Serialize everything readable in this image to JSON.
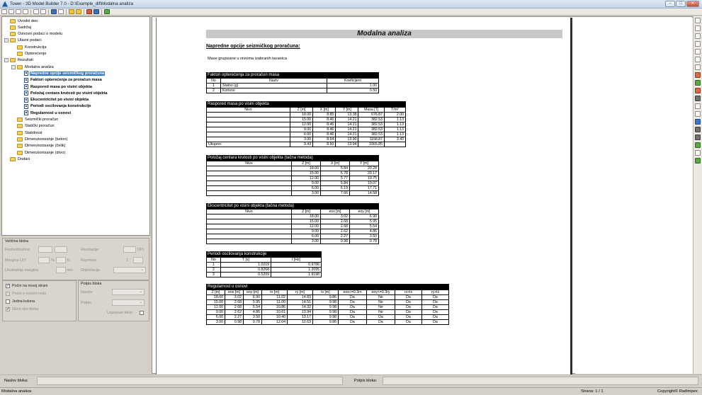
{
  "window": {
    "title": "Tower - 3D Model Builder 7.0 - D:\\Example_dif\\Modalna analiza",
    "minimize": "–",
    "maximize": "□",
    "close": "✕"
  },
  "tree": [
    {
      "label": "Uvodni deo",
      "indent": 0,
      "icon": "folder",
      "expander": "",
      "bold": false,
      "selected": false
    },
    {
      "label": "Sadržaj",
      "indent": 0,
      "icon": "folder",
      "expander": "",
      "bold": false,
      "selected": false
    },
    {
      "label": "Osnovni podaci o modelu",
      "indent": 0,
      "icon": "folder",
      "expander": "",
      "bold": false,
      "selected": false
    },
    {
      "label": "Ulazni podaci",
      "indent": 0,
      "icon": "folder",
      "expander": "−",
      "bold": false,
      "selected": false
    },
    {
      "label": "Konstrukcija",
      "indent": 1,
      "icon": "folder",
      "expander": "",
      "bold": false,
      "selected": false
    },
    {
      "label": "Opterećenje",
      "indent": 1,
      "icon": "folder",
      "expander": "",
      "bold": false,
      "selected": false
    },
    {
      "label": "Rezultati",
      "indent": 0,
      "icon": "folder",
      "expander": "−",
      "bold": false,
      "selected": false
    },
    {
      "label": "Modalna analiza",
      "indent": 1,
      "icon": "folder",
      "expander": "−",
      "bold": false,
      "selected": false
    },
    {
      "label": "Napredne opcije seizmičkog proračuna",
      "indent": 2,
      "icon": "doc",
      "expander": "",
      "bold": true,
      "selected": true
    },
    {
      "label": "Faktori opterećenja za proračun masa",
      "indent": 2,
      "icon": "doc",
      "expander": "",
      "bold": true,
      "selected": false
    },
    {
      "label": "Raspored masa po visini objekta",
      "indent": 2,
      "icon": "doc",
      "expander": "",
      "bold": true,
      "selected": false
    },
    {
      "label": "Položaj centara krutosti po visini objekta",
      "indent": 2,
      "icon": "doc",
      "expander": "",
      "bold": true,
      "selected": false
    },
    {
      "label": "Ekscentricitet po visini objekta",
      "indent": 2,
      "icon": "doc",
      "expander": "",
      "bold": true,
      "selected": false
    },
    {
      "label": "Periodi oscilovanja konstrukcije",
      "indent": 2,
      "icon": "doc",
      "expander": "",
      "bold": true,
      "selected": false
    },
    {
      "label": "Regularnost u osnovi",
      "indent": 2,
      "icon": "doc",
      "expander": "",
      "bold": true,
      "selected": false
    },
    {
      "label": "Seizmički proračun",
      "indent": 1,
      "icon": "folder",
      "expander": "",
      "bold": false,
      "selected": false
    },
    {
      "label": "Statički proračun",
      "indent": 1,
      "icon": "folder",
      "expander": "",
      "bold": false,
      "selected": false
    },
    {
      "label": "Stabilnost",
      "indent": 1,
      "icon": "folder",
      "expander": "",
      "bold": false,
      "selected": false
    },
    {
      "label": "Dimenzionisanje (beton)",
      "indent": 1,
      "icon": "folder",
      "expander": "",
      "bold": false,
      "selected": false
    },
    {
      "label": "Dimenzionisanje (čelik)",
      "indent": 1,
      "icon": "folder",
      "expander": "",
      "bold": false,
      "selected": false
    },
    {
      "label": "Dimenzionisanje (drvo)",
      "indent": 1,
      "icon": "folder",
      "expander": "",
      "bold": false,
      "selected": false
    },
    {
      "label": "Dodaci",
      "indent": 0,
      "icon": "folder",
      "expander": "",
      "bold": false,
      "selected": false
    }
  ],
  "panel": {
    "block_size_title": "Veličina bloka",
    "redovi_kolone": "Redovi/Kolone",
    "margina_ud": "Margina U/Y",
    "unutrasnja_margina": "Unutrašnja margina",
    "pct1": "%",
    "pct2": "%",
    "mm": "mm",
    "rezolucija": "Rezolucija",
    "dpi": "DPI",
    "razmera": "Razmera",
    "razmera_val": "1 :",
    "orijentacija": "Orijentacija",
    "pocni_novoj_strani": "Počni na novoj strani",
    "pocni_novom_redu": "Počni u novom redu",
    "jedna_kolona": "Jedna kolona",
    "okvir_oko_bloka": "Okvir oko bloka",
    "potpis_bloka_title": "Potpis bloka",
    "naslov": "Naslov",
    "potpis": "Potpis",
    "uspravan_tekst": "Uspravan tekst"
  },
  "report": {
    "title": "Modalna analiza",
    "heading": "Napredne opcije seizmičkog proračuna:",
    "note": "Mase grupisane u nivoima izabranih tavanica",
    "t1": {
      "caption": "Faktori opterećenja za proračun masa",
      "headers": [
        "No",
        "Naziv",
        "Koeficijent"
      ],
      "rows": [
        [
          "1",
          "Stalno (g)",
          "1.00"
        ],
        [
          "2",
          "Korisno",
          "0.50"
        ]
      ]
    },
    "t2": {
      "caption": "Raspored masa po visini objekta",
      "headers": [
        "Nivo",
        "Z [m]",
        "X [m]",
        "Y [m]",
        "Masa [T]",
        "T/m²"
      ],
      "rows": [
        [
          "",
          "18.00",
          "8.85",
          "13.38",
          "676.87",
          "2.00"
        ],
        [
          "",
          "15.00",
          "8.46",
          "14.21",
          "382.53",
          "1.13"
        ],
        [
          "",
          "12.00",
          "8.46",
          "14.21",
          "382.53",
          "1.13"
        ],
        [
          "",
          "9.00",
          "8.46",
          "14.21",
          "382.53",
          "1.13"
        ],
        [
          "",
          "6.00",
          "8.46",
          "14.21",
          "382.53",
          "1.13"
        ],
        [
          "",
          "3.00",
          "8.64",
          "13.90",
          "1158.87",
          "3.43"
        ],
        [
          "Ukupno:",
          "9.43",
          "8.50",
          "13.94",
          "3365.85",
          ""
        ]
      ]
    },
    "t3": {
      "caption": "Položaj centara krutosti po visini objekta (tačna metoda)",
      "headers": [
        "Nivo",
        "Z [m]",
        "X [m]",
        "Y [m]"
      ],
      "rows": [
        [
          "",
          "18.00",
          "5.84",
          "20.28"
        ],
        [
          "",
          "15.00",
          "5.78",
          "20.17"
        ],
        [
          "",
          "12.00",
          "5.77",
          "19.75"
        ],
        [
          "",
          "9.00",
          "5.84",
          "19.07"
        ],
        [
          "",
          "6.00",
          "6.19",
          "17.71"
        ],
        [
          "",
          "3.00",
          "7.66",
          "14.58"
        ]
      ]
    },
    "t4": {
      "caption": "Ekscentricitet po visini objekta (tačna metoda)",
      "headers": [
        "Nivo",
        "Z [m]",
        "eox [m]",
        "eoy [m]"
      ],
      "rows": [
        [
          "",
          "18.00",
          "3.02",
          "6.90"
        ],
        [
          "",
          "15.00",
          "2.68",
          "5.95"
        ],
        [
          "",
          "12.00",
          "2.68",
          "5.54"
        ],
        [
          "",
          "9.00",
          "2.62",
          "4.86"
        ],
        [
          "",
          "6.00",
          "2.27",
          "3.50"
        ],
        [
          "",
          "3.00",
          "0.98",
          "0.78"
        ]
      ]
    },
    "t5": {
      "caption": "Periodi oscilovanja konstrukcije",
      "headers": [
        "No",
        "T [s]",
        "f [Hz]"
      ],
      "rows": [
        [
          "1",
          "1.0219",
          "0.9786"
        ],
        [
          "2",
          "0.8268",
          "1.2095"
        ],
        [
          "3",
          "0.5209",
          "1.9198"
        ]
      ]
    },
    "t6": {
      "caption": "Regularnost u osnovi",
      "headers": [
        "Z [m]",
        "eox [m]",
        "eoy [m]",
        "rx [m]",
        "ry [m]",
        "ls [m]",
        "eox<=0.3rx",
        "eoy<=0.3ry",
        "rx>ls",
        "ry>ls"
      ],
      "rows": [
        [
          "18.00",
          "3.02",
          "6.90",
          "11.02",
          "14.83",
          "9.86",
          "Da",
          "Ne",
          "Da",
          "Da"
        ],
        [
          "15.00",
          "2.68",
          "5.95",
          "11.00",
          "14.51",
          "9.98",
          "Da",
          "Ne",
          "Da",
          "Da"
        ],
        [
          "12.00",
          "2.68",
          "5.54",
          "10.86",
          "14.32",
          "9.98",
          "Da",
          "Ne",
          "Da",
          "Da"
        ],
        [
          "9.00",
          "2.62",
          "4.86",
          "10.61",
          "13.94",
          "9.98",
          "Da",
          "Ne",
          "Da",
          "Da"
        ],
        [
          "6.00",
          "2.27",
          "3.50",
          "10.40",
          "13.17",
          "9.98",
          "Da",
          "Da",
          "Da",
          "Da"
        ],
        [
          "3.00",
          "0.98",
          "0.78",
          "12.04",
          "12.63",
          "9.86",
          "Da",
          "Da",
          "Da",
          "Da"
        ]
      ]
    }
  },
  "bottom": {
    "naslov_bloka": "Naslov bloka:",
    "potpis_bloka": "Potpis bloka:"
  },
  "status": {
    "left": "Modalna analiza",
    "page": "Strana: 1 / 1",
    "copyright": "Copyright© Radimpex"
  }
}
